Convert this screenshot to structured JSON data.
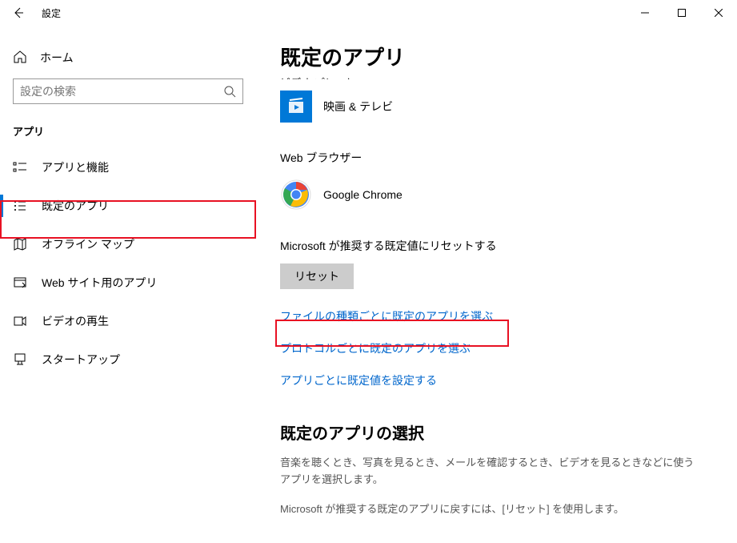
{
  "titlebar": {
    "title": "設定"
  },
  "sidebar": {
    "home": "ホーム",
    "search_placeholder": "設定の検索",
    "section": "アプリ",
    "items": [
      {
        "label": "アプリと機能"
      },
      {
        "label": "既定のアプリ"
      },
      {
        "label": "オフライン マップ"
      },
      {
        "label": "Web サイト用のアプリ"
      },
      {
        "label": "ビデオの再生"
      },
      {
        "label": "スタートアップ"
      }
    ]
  },
  "main": {
    "title": "既定のアプリ",
    "video_section": "ビデオ プレーヤー",
    "video_app": "映画 & テレビ",
    "browser_section": "Web ブラウザー",
    "browser_app": "Google Chrome",
    "reset_text": "Microsoft が推奨する既定値にリセットする",
    "reset_button": "リセット",
    "links": [
      "ファイルの種類ごとに既定のアプリを選ぶ",
      "プロトコルごとに既定のアプリを選ぶ",
      "アプリごとに既定値を設定する"
    ],
    "choose_title": "既定のアプリの選択",
    "choose_desc": "音楽を聴くとき、写真を見るとき、メールを確認するとき、ビデオを見るときなどに使うアプリを選択します。",
    "choose_desc2": "Microsoft が推奨する既定のアプリに戻すには、[リセット] を使用します。"
  }
}
